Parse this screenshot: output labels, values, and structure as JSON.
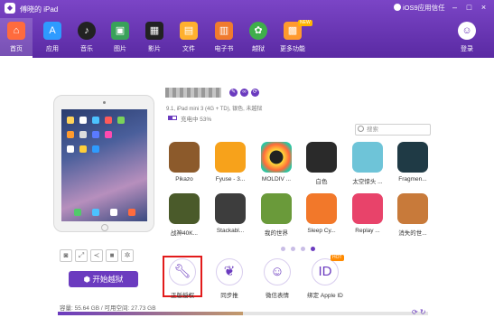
{
  "window": {
    "title": "傅晓的 iPad",
    "ios_badge": "iOS9应用信任",
    "controls": [
      "minimize",
      "restore",
      "close"
    ]
  },
  "nav": {
    "items": [
      {
        "label": "首页",
        "icon": "home-icon",
        "color": "#ff6b3d",
        "active": true
      },
      {
        "label": "应用",
        "icon": "appstore-icon",
        "color": "#2e9bff"
      },
      {
        "label": "音乐",
        "icon": "music-icon",
        "color": "#222222"
      },
      {
        "label": "图片",
        "icon": "picture-icon",
        "color": "#39a15a"
      },
      {
        "label": "影片",
        "icon": "film-icon",
        "color": "#222222"
      },
      {
        "label": "文件",
        "icon": "folder-icon",
        "color": "#ffb02e"
      },
      {
        "label": "电子书",
        "icon": "book-icon",
        "color": "#f07b2e"
      },
      {
        "label": "越狱",
        "icon": "jailbreak-icon",
        "color": "#3fae4a"
      },
      {
        "label": "更多功能",
        "icon": "more-icon",
        "color": "#ff9a2e",
        "badge": "NEW"
      }
    ],
    "login_label": "登录"
  },
  "device": {
    "info": "9.1, iPad mini 3 (4G + TD), 银色, 未越狱",
    "battery_text": "充电中 53%",
    "battery_level": 0.53,
    "tools": [
      "camera-icon",
      "expand-icon",
      "share-icon",
      "media-icon",
      "settings-icon"
    ],
    "jailbreak_button": "开始越狱"
  },
  "search": {
    "placeholder": "搜索"
  },
  "apps": [
    {
      "name": "Pikazo",
      "color": "#8c5a2b"
    },
    {
      "name": "Fyuse - 3...",
      "color": "#f7a21b"
    },
    {
      "name": "MOLDIV ...",
      "color": "#ffdb3a"
    },
    {
      "name": "白色",
      "color": "#2a2a2a"
    },
    {
      "name": "太空惊头 ...",
      "color": "#6ec4d8"
    },
    {
      "name": "Fragmen...",
      "color": "#1f3a45"
    },
    {
      "name": "战神40K...",
      "color": "#4a5a2a"
    },
    {
      "name": "Stackabl...",
      "color": "#3d3d3d"
    },
    {
      "name": "我的世界",
      "color": "#6a9a3a"
    },
    {
      "name": "Sleep Cy...",
      "color": "#f2782a"
    },
    {
      "name": "Replay ...",
      "color": "#e8436a"
    },
    {
      "name": "消失的世...",
      "color": "#c87a3a"
    }
  ],
  "pager": {
    "pages": 4,
    "current": 4
  },
  "tools": [
    {
      "label": "正版授权",
      "icon": "wrench-icon",
      "highlight": true
    },
    {
      "label": "同步推",
      "icon": "tongbutui-icon"
    },
    {
      "label": "微信表情",
      "icon": "smile-icon"
    },
    {
      "label": "绑定 Apple ID",
      "icon": "appleid-icon",
      "badge": "HOT"
    }
  ],
  "storage": {
    "text": "容量: 55.64 GB / 可用空间: 27.73 GB",
    "used_fraction": 0.5
  }
}
